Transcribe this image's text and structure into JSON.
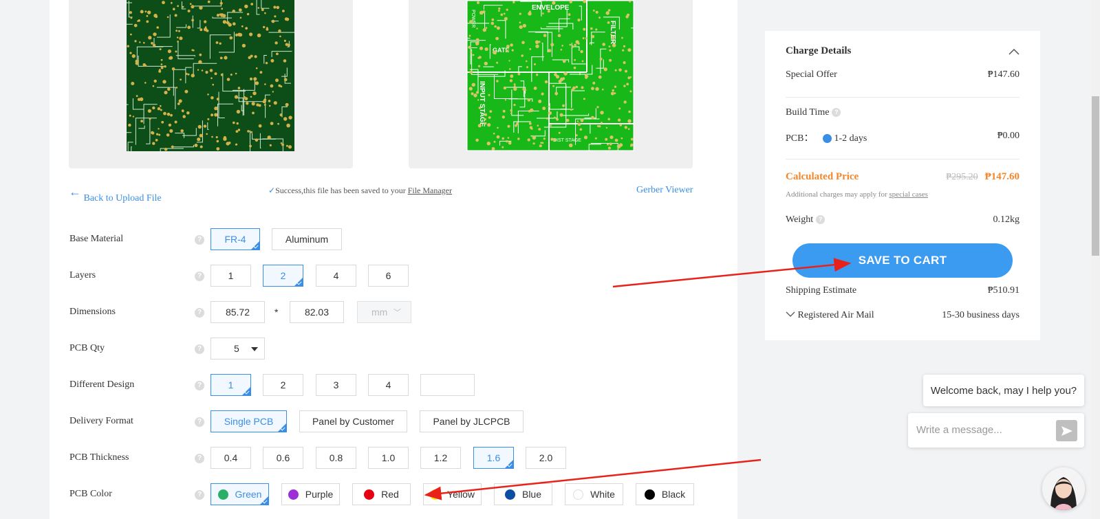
{
  "links": {
    "back": "Back to Upload File",
    "success_prefix": "Success,this file has been saved to your ",
    "file_manager": "File Manager",
    "gerber_viewer": "Gerber Viewer"
  },
  "options": {
    "base_material": {
      "label": "Base Material",
      "choices": [
        "FR-4",
        "Aluminum"
      ],
      "selected": "FR-4"
    },
    "layers": {
      "label": "Layers",
      "choices": [
        "1",
        "2",
        "4",
        "6"
      ],
      "selected": "2"
    },
    "dimensions": {
      "label": "Dimensions",
      "width": "85.72",
      "times": "*",
      "height": "82.03",
      "unit": "mm"
    },
    "pcb_qty": {
      "label": "PCB Qty",
      "value": "5"
    },
    "different_design": {
      "label": "Different Design",
      "choices": [
        "1",
        "2",
        "3",
        "4",
        ""
      ],
      "selected": "1"
    },
    "delivery_format": {
      "label": "Delivery Format",
      "choices": [
        "Single PCB",
        "Panel by Customer",
        "Panel by JLCPCB"
      ],
      "selected": "Single PCB"
    },
    "pcb_thickness": {
      "label": "PCB Thickness",
      "choices": [
        "0.4",
        "0.6",
        "0.8",
        "1.0",
        "1.2",
        "1.6",
        "2.0"
      ],
      "selected": "1.6"
    },
    "pcb_color": {
      "label": "PCB Color",
      "choices": [
        {
          "name": "Green",
          "color": "#2bae66"
        },
        {
          "name": "Purple",
          "color": "#9b30d9"
        },
        {
          "name": "Red",
          "color": "#e60012"
        },
        {
          "name": "Yellow",
          "color": "#ffe600"
        },
        {
          "name": "Blue",
          "color": "#0b4ea2"
        },
        {
          "name": "White",
          "color": "#ffffff"
        },
        {
          "name": "Black",
          "color": "#000000"
        }
      ],
      "selected": "Green"
    },
    "help": "?"
  },
  "charge": {
    "title": "Charge Details",
    "special_offer_label": "Special Offer",
    "special_offer_value": "₱147.60",
    "build_time_label": "Build Time",
    "pcb_label": "PCB：",
    "pcb_days": "1-2 days",
    "pcb_value": "₱0.00",
    "calc_label": "Calculated Price",
    "calc_old": "₱295.20",
    "calc_new": "₱147.60",
    "additional_text": "Additional charges may apply for ",
    "special_cases": "special cases",
    "weight_label": "Weight",
    "weight_value": "0.12kg",
    "save_button": "SAVE TO CART",
    "shipping_label": "Shipping Estimate",
    "shipping_value": "₱510.91",
    "mail_label": "Registered Air Mail",
    "mail_days": "15-30 business days"
  },
  "chat": {
    "welcome": "Welcome back, may I help you?",
    "placeholder": "Write a message..."
  },
  "pcb_silkscreen": {
    "envelope": "ENVELOPE",
    "filter": "FILTER",
    "gate": "GATE",
    "input_stage": "INPUT STAGE",
    "dist_stage": "DIST STAGE",
    "power": "POWER"
  },
  "colors": {
    "accent": "#3a8ee6",
    "price_orange": "#f5862a",
    "annotation_red": "#e8221b"
  }
}
